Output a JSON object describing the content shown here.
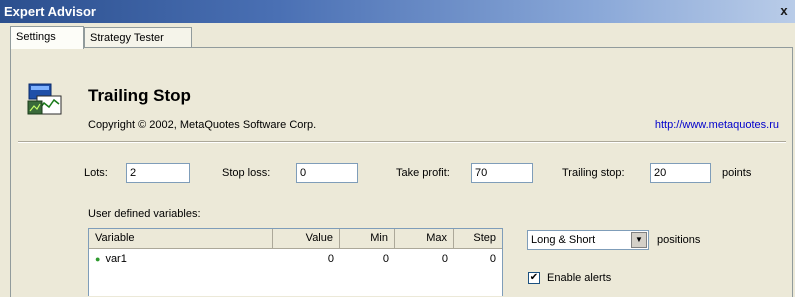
{
  "window": {
    "title": "Expert Advisor",
    "close_glyph": "x"
  },
  "tabs": [
    {
      "label": "Settings"
    },
    {
      "label": "Strategy Tester"
    }
  ],
  "advisor": {
    "icon": "expert-advisor-icon",
    "name": "Trailing Stop",
    "copyright": "Copyright © 2002, MetaQuotes Software Corp.",
    "link": "http://www.metaquotes.ru"
  },
  "fields": {
    "lots": {
      "label": "Lots:",
      "value": "2"
    },
    "stop_loss": {
      "label": "Stop loss:",
      "value": "0"
    },
    "take_profit": {
      "label": "Take profit:",
      "value": "70"
    },
    "trailing_stop": {
      "label": "Trailing stop:",
      "value": "20"
    },
    "unit": "points"
  },
  "variables": {
    "label": "User defined variables:",
    "columns": [
      "Variable",
      "Value",
      "Min",
      "Max",
      "Step"
    ],
    "rows": [
      {
        "variable": "var1",
        "value": "0",
        "min": "0",
        "max": "0",
        "step": "0"
      }
    ]
  },
  "positions": {
    "selected": "Long & Short",
    "label": "positions"
  },
  "alerts": {
    "label": "Enable alerts",
    "checked": true
  }
}
